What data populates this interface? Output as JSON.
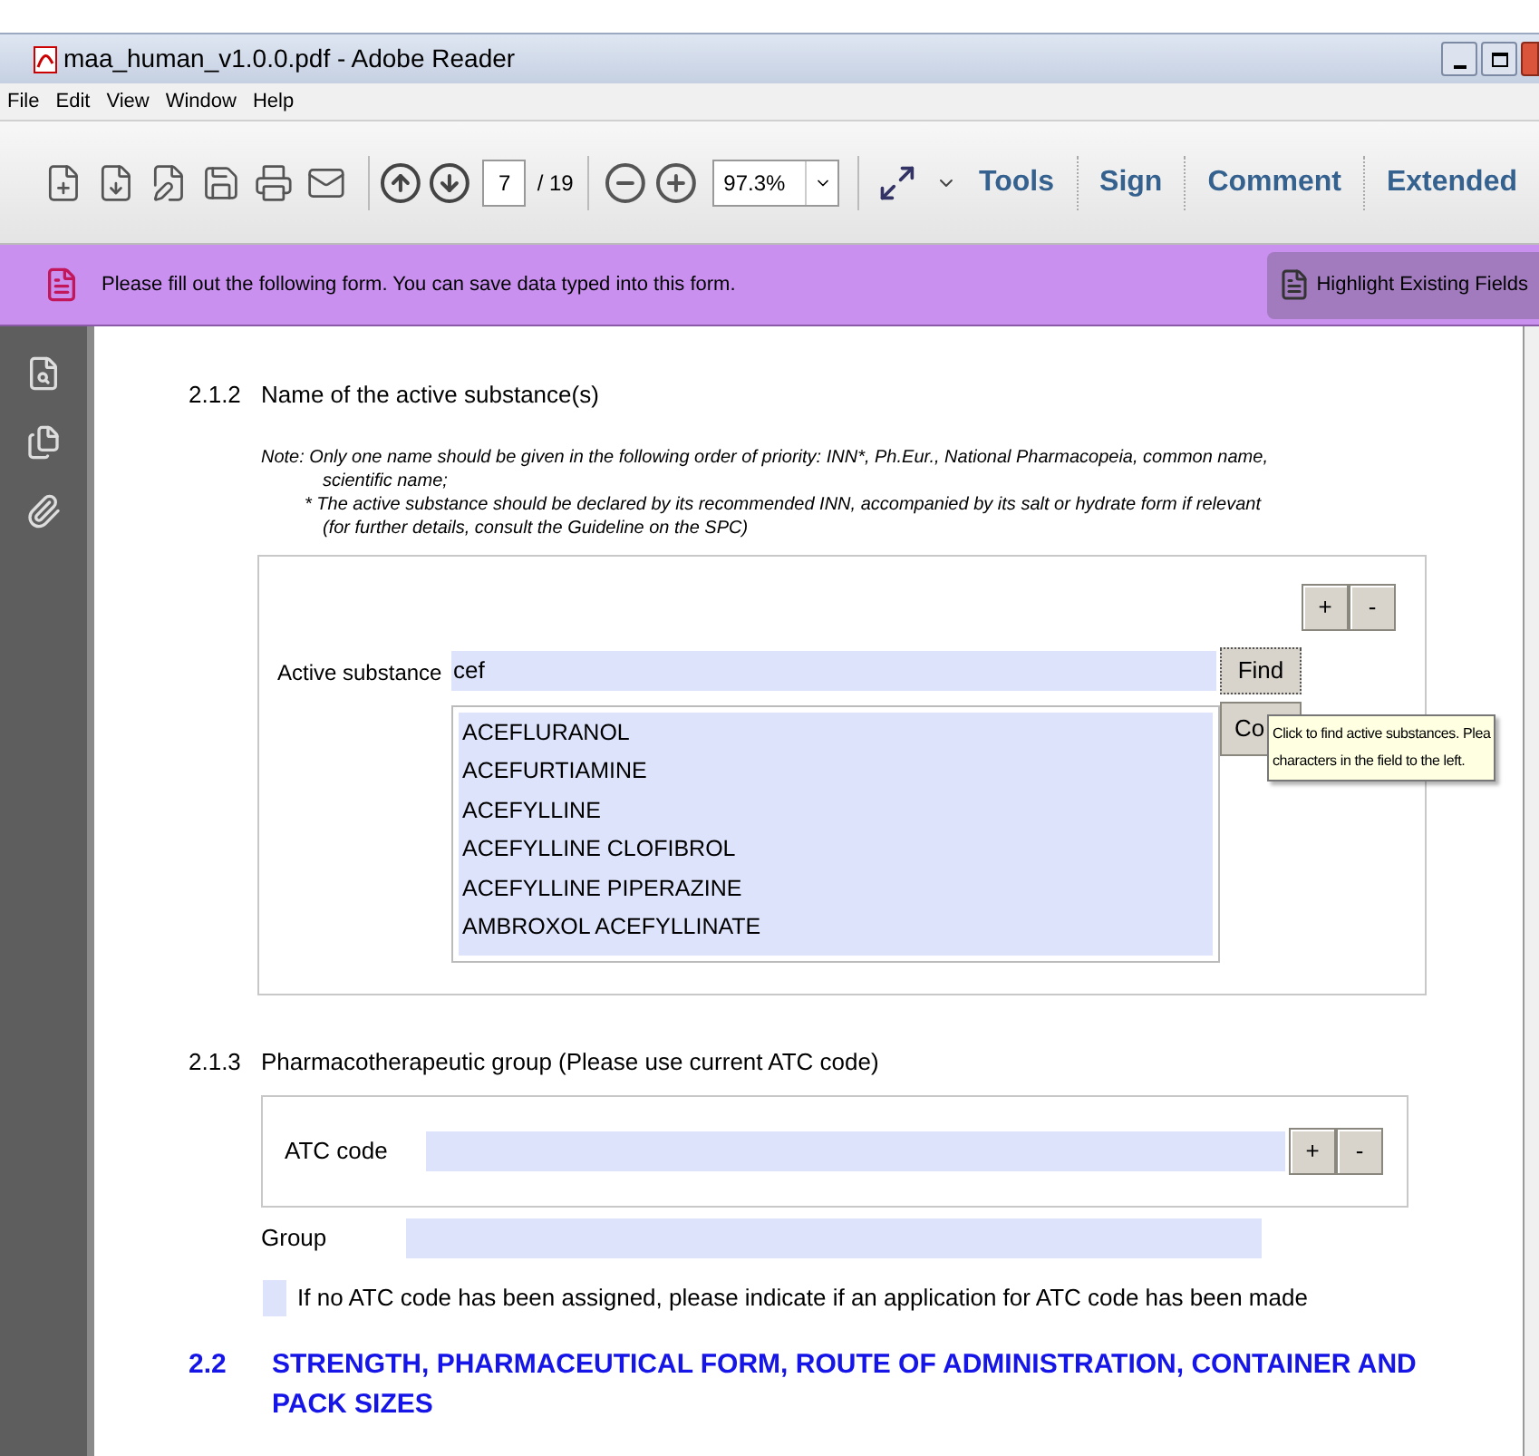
{
  "window": {
    "title": "maa_human_v1.0.0.pdf - Adobe Reader"
  },
  "menu": [
    "File",
    "Edit",
    "View",
    "Window",
    "Help"
  ],
  "toolbar": {
    "page": "7",
    "page_count": "/ 19",
    "zoom": "97.3%",
    "panes": [
      "Tools",
      "Sign",
      "Comment",
      "Extended"
    ]
  },
  "form_bar": {
    "message": "Please fill out the following form. You can save data typed into this form.",
    "button": "Highlight Existing Fields"
  },
  "section_212": {
    "number": "2.1.2",
    "title": "Name of the active substance(s)",
    "note_lines": [
      "Note: Only one name should be given in the following order of priority: INN*, Ph.Eur., National Pharmacopeia, common name,",
      "scientific name;",
      "* The active substance should be declared by its recommended INN, accompanied by its salt or hydrate form if relevant",
      "(for further details, consult the Guideline on the SPC)"
    ],
    "add_button": "+",
    "remove_button": "-",
    "label": "Active substance",
    "value": "cef",
    "find_button": "Find",
    "second_button": "Co",
    "results": [
      "ACEFLURANOL",
      "ACEFURTIAMINE",
      "ACEFYLLINE",
      "ACEFYLLINE CLOFIBROL",
      "ACEFYLLINE PIPERAZINE",
      "AMBROXOL ACEFYLLINATE"
    ],
    "tooltip_lines": [
      "Click to find active substances. Plea",
      "characters in the field to the left."
    ]
  },
  "section_213": {
    "number": "2.1.3",
    "title": "Pharmacotherapeutic group (Please use current ATC code)",
    "atc_label": "ATC code",
    "add_button": "+",
    "remove_button": "-",
    "group_label": "Group",
    "checkbox": {
      "label": "If no ATC code has been assigned, please indicate if an application for ATC code has been made",
      "checked": false
    }
  },
  "section_22": {
    "number": "2.2",
    "title": "STRENGTH, PHARMACEUTICAL FORM, ROUTE OF ADMINISTRATION, CONTAINER AND PACK SIZES"
  }
}
